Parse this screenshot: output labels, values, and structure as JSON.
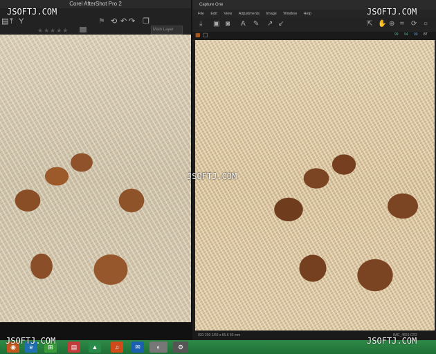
{
  "left_window": {
    "title": "Corel AfterShot Pro 2",
    "stars": "★★★★★",
    "layer_select": "Main Layer"
  },
  "right_window": {
    "title": "Capture One",
    "menu": [
      "File",
      "Edit",
      "View",
      "Adjustments",
      "Image",
      "Window",
      "Help"
    ],
    "channels": [
      "99",
      "94",
      "99",
      "87"
    ],
    "status_left": "ISO 200  1/60 s  f/5.6  50 mm",
    "status_right": "IMG_4659.CR2"
  },
  "watermark": "JSOFTJ.COM",
  "colors": {
    "taskbar": "#2f8a46",
    "accent_orange": "#e07020"
  },
  "icons": {
    "left_toolbar": [
      "arrow-up-icon",
      "filter-icon",
      "rotate-left-icon",
      "rotate-right-icon"
    ],
    "taskbar": [
      "firefox-icon",
      "ie-icon",
      "store-icon",
      "news-icon",
      "finance-icon",
      "music-icon",
      "mail-icon",
      "app-icon",
      "tools-icon"
    ]
  }
}
